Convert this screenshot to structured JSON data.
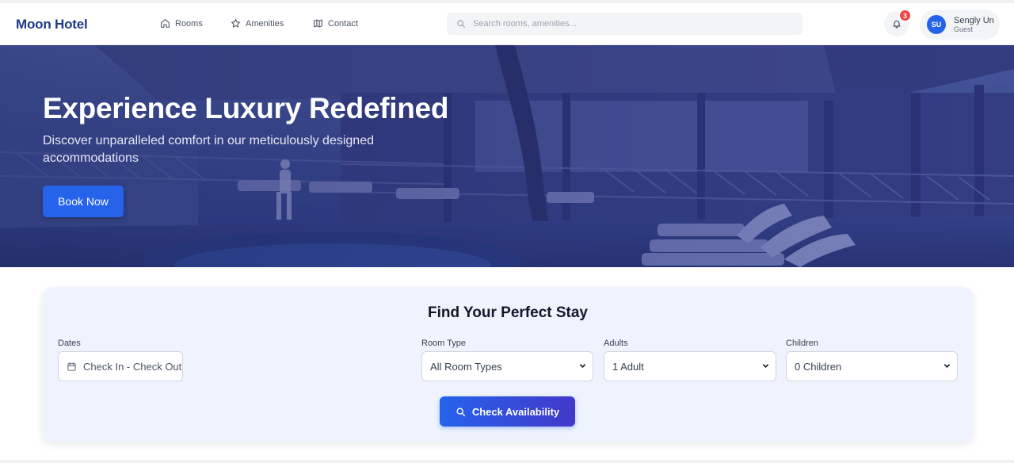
{
  "navbar": {
    "brand": "Moon Hotel",
    "links": [
      {
        "label": "Rooms",
        "icon": "home-icon"
      },
      {
        "label": "Amenities",
        "icon": "star-icon"
      },
      {
        "label": "Contact",
        "icon": "map-icon"
      }
    ],
    "search_placeholder": "Search rooms, amenities...",
    "notification_count": "3",
    "user": {
      "initials": "SU",
      "name": "Sengly Un",
      "role": "Guest"
    }
  },
  "hero": {
    "title": "Experience Luxury Redefined",
    "subtitle": "Discover unparalleled comfort in our meticulously designed accommodations",
    "cta_label": "Book Now"
  },
  "booking": {
    "title": "Find Your Perfect Stay",
    "dates": {
      "label": "Dates",
      "value": "Check In - Check Out"
    },
    "room_type": {
      "label": "Room Type",
      "value": "All Room Types"
    },
    "adults": {
      "label": "Adults",
      "value": "1 Adult"
    },
    "children": {
      "label": "Children",
      "value": "0 Children"
    },
    "submit_label": "Check Availability"
  },
  "colors": {
    "brand": "#1e3a8a",
    "primary": "#2563eb",
    "accent_gradient_end": "#4338ca",
    "badge": "#ef4444",
    "card_bg": "#eef3fe"
  }
}
